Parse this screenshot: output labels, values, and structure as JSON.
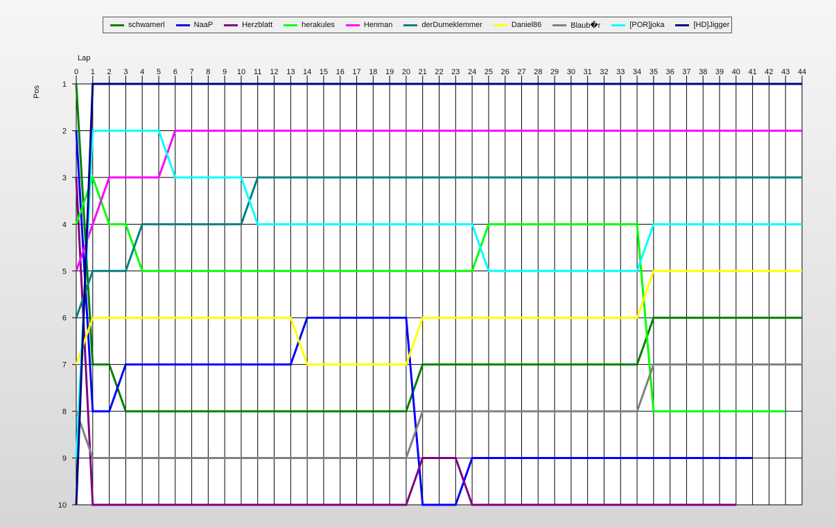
{
  "chart_data": {
    "type": "line",
    "xlabel": "Lap",
    "ylabel": "Pos",
    "xlim": [
      0,
      44
    ],
    "ylim": [
      1,
      10
    ],
    "y_inverted": true,
    "grid": true,
    "legend_position": "top",
    "x": [
      0,
      1,
      2,
      3,
      4,
      5,
      6,
      7,
      8,
      9,
      10,
      11,
      12,
      13,
      14,
      15,
      16,
      17,
      18,
      19,
      20,
      21,
      22,
      23,
      24,
      25,
      26,
      27,
      28,
      29,
      30,
      31,
      32,
      33,
      34,
      35,
      36,
      37,
      38,
      39,
      40,
      41,
      42,
      43,
      44
    ],
    "y_ticks": [
      1,
      2,
      3,
      4,
      5,
      6,
      7,
      8,
      9,
      10
    ],
    "series": [
      {
        "name": "schwamerl",
        "color": "#008000",
        "values": [
          1,
          7,
          7,
          8,
          8,
          8,
          8,
          8,
          8,
          8,
          8,
          8,
          8,
          8,
          8,
          8,
          8,
          8,
          8,
          8,
          8,
          7,
          7,
          7,
          7,
          7,
          7,
          7,
          7,
          7,
          7,
          7,
          7,
          7,
          7,
          6,
          6,
          6,
          6,
          6,
          6,
          6,
          6,
          6,
          6
        ]
      },
      {
        "name": "NaaP",
        "color": "#0000ff",
        "values": [
          2,
          8,
          8,
          7,
          7,
          7,
          7,
          7,
          7,
          7,
          7,
          7,
          7,
          7,
          6,
          6,
          6,
          6,
          6,
          6,
          6,
          10,
          10,
          10,
          9,
          9,
          9,
          9,
          9,
          9,
          9,
          9,
          9,
          9,
          9,
          9,
          9,
          9,
          9,
          9,
          9,
          9
        ]
      },
      {
        "name": "Herzblatt",
        "color": "#800080",
        "values": [
          3,
          10,
          10,
          10,
          10,
          10,
          10,
          10,
          10,
          10,
          10,
          10,
          10,
          10,
          10,
          10,
          10,
          10,
          10,
          10,
          10,
          9,
          9,
          9,
          10,
          10,
          10,
          10,
          10,
          10,
          10,
          10,
          10,
          10,
          10,
          10,
          10,
          10,
          10,
          10,
          10
        ]
      },
      {
        "name": "herakules",
        "color": "#00ff00",
        "values": [
          4,
          3,
          4,
          4,
          5,
          5,
          5,
          5,
          5,
          5,
          5,
          5,
          5,
          5,
          5,
          5,
          5,
          5,
          5,
          5,
          5,
          5,
          5,
          5,
          5,
          4,
          4,
          4,
          4,
          4,
          4,
          4,
          4,
          4,
          4,
          8,
          8,
          8,
          8,
          8,
          8,
          8,
          8,
          8
        ]
      },
      {
        "name": "Henman",
        "color": "#ff00ff",
        "values": [
          5,
          4,
          3,
          3,
          3,
          3,
          2,
          2,
          2,
          2,
          2,
          2,
          2,
          2,
          2,
          2,
          2,
          2,
          2,
          2,
          2,
          2,
          2,
          2,
          2,
          2,
          2,
          2,
          2,
          2,
          2,
          2,
          2,
          2,
          2,
          2,
          2,
          2,
          2,
          2,
          2,
          2,
          2,
          2,
          2
        ]
      },
      {
        "name": "derDumeklemmer",
        "color": "#008080",
        "values": [
          6,
          5,
          5,
          5,
          4,
          4,
          4,
          4,
          4,
          4,
          4,
          3,
          3,
          3,
          3,
          3,
          3,
          3,
          3,
          3,
          3,
          3,
          3,
          3,
          3,
          3,
          3,
          3,
          3,
          3,
          3,
          3,
          3,
          3,
          3,
          3,
          3,
          3,
          3,
          3,
          3,
          3,
          3,
          3,
          3
        ]
      },
      {
        "name": "Daniel86",
        "color": "#ffff00",
        "values": [
          7,
          6,
          6,
          6,
          6,
          6,
          6,
          6,
          6,
          6,
          6,
          6,
          6,
          6,
          7,
          7,
          7,
          7,
          7,
          7,
          7,
          6,
          6,
          6,
          6,
          6,
          6,
          6,
          6,
          6,
          6,
          6,
          6,
          6,
          6,
          5,
          5,
          5,
          5,
          5,
          5,
          5,
          5,
          5,
          5
        ]
      },
      {
        "name": "Blaub�r",
        "color": "#808080",
        "values": [
          8,
          9,
          9,
          9,
          9,
          9,
          9,
          9,
          9,
          9,
          9,
          9,
          9,
          9,
          9,
          9,
          9,
          9,
          9,
          9,
          9,
          8,
          8,
          8,
          8,
          8,
          8,
          8,
          8,
          8,
          8,
          8,
          8,
          8,
          8,
          7,
          7,
          7,
          7,
          7,
          7,
          7,
          7,
          7,
          7
        ]
      },
      {
        "name": "[POR]joka",
        "color": "#00ffff",
        "values": [
          9,
          2,
          2,
          2,
          2,
          2,
          3,
          3,
          3,
          3,
          3,
          4,
          4,
          4,
          4,
          4,
          4,
          4,
          4,
          4,
          4,
          4,
          4,
          4,
          4,
          5,
          5,
          5,
          5,
          5,
          5,
          5,
          5,
          5,
          5,
          4,
          4,
          4,
          4,
          4,
          4,
          4,
          4,
          4,
          4
        ]
      },
      {
        "name": "[HD]Jigger",
        "color": "#000080",
        "values": [
          10,
          1,
          1,
          1,
          1,
          1,
          1,
          1,
          1,
          1,
          1,
          1,
          1,
          1,
          1,
          1,
          1,
          1,
          1,
          1,
          1,
          1,
          1,
          1,
          1,
          1,
          1,
          1,
          1,
          1,
          1,
          1,
          1,
          1,
          1,
          1,
          1,
          1,
          1,
          1,
          1,
          1,
          1,
          1,
          1
        ]
      }
    ]
  }
}
